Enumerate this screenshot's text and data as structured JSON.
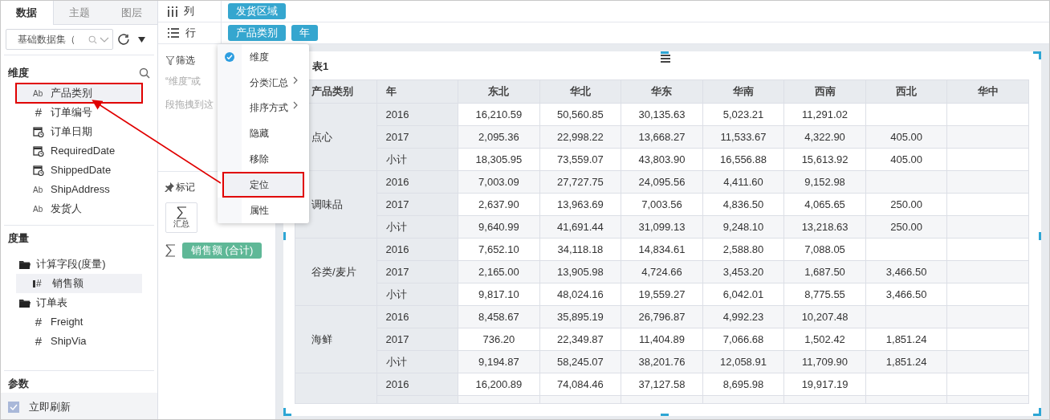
{
  "sidebar": {
    "tabs": [
      {
        "label": "数据",
        "selected": true
      },
      {
        "label": "主题",
        "selected": false
      },
      {
        "label": "图层",
        "selected": false
      }
    ],
    "dataset": {
      "value": "基础数据集（"
    },
    "dimensions": {
      "title": "维度",
      "items": [
        {
          "kind": "text",
          "glyph": "Ab",
          "label": "产品类别",
          "selected": true,
          "annotated": true
        },
        {
          "kind": "number",
          "glyph": "#",
          "label": "订单编号",
          "selected": false,
          "annotated": false
        },
        {
          "kind": "date",
          "label": "订单日期",
          "selected": false,
          "annotated": false
        },
        {
          "kind": "date",
          "label": "RequiredDate",
          "selected": false,
          "annotated": false
        },
        {
          "kind": "date",
          "label": "ShippedDate",
          "selected": false,
          "annotated": false
        },
        {
          "kind": "text",
          "glyph": "Ab",
          "label": "ShipAddress",
          "selected": false,
          "annotated": false
        },
        {
          "kind": "text",
          "glyph": "Ab",
          "label": "发货人",
          "selected": false,
          "annotated": false
        }
      ]
    },
    "measures": {
      "title": "度量",
      "folders": [
        {
          "label": "计算字段(度量)",
          "children": [
            {
              "kind": "measure",
              "glyph": "#",
              "label": "销售额",
              "selected": true
            }
          ]
        },
        {
          "label": "订单表",
          "children": [
            {
              "kind": "number",
              "glyph": "#",
              "label": "Freight",
              "selected": false
            },
            {
              "kind": "number",
              "glyph": "#",
              "label": "ShipVia",
              "selected": false
            }
          ]
        }
      ]
    },
    "params": {
      "title": "参数"
    },
    "auto_refresh": {
      "label": "立即刷新",
      "checked": true
    }
  },
  "shelves": [
    {
      "kind": "columns",
      "label": "列",
      "pills": [
        "发货区域"
      ]
    },
    {
      "kind": "rows",
      "label": "行",
      "pills": [
        "产品类别",
        "年"
      ]
    }
  ],
  "filter": {
    "title": "筛选",
    "hint_lines": [
      "“维度”或",
      "段拖拽到这"
    ]
  },
  "marks": {
    "title": "标记",
    "button": "汇总",
    "measure_pill": "销售额 (合计)"
  },
  "context_menu": {
    "items": [
      {
        "label": "维度",
        "checked": true,
        "submenu": false,
        "hovered": false,
        "annotated": false
      },
      {
        "label": "分类汇总",
        "checked": false,
        "submenu": true,
        "hovered": false,
        "annotated": false
      },
      {
        "label": "排序方式",
        "checked": false,
        "submenu": true,
        "hovered": false,
        "annotated": false
      },
      {
        "label": "隐藏",
        "checked": false,
        "submenu": false,
        "hovered": false,
        "annotated": false
      },
      {
        "label": "移除",
        "checked": false,
        "submenu": false,
        "hovered": false,
        "annotated": false
      },
      {
        "label": "定位",
        "checked": false,
        "submenu": false,
        "hovered": true,
        "annotated": true
      },
      {
        "label": "属性",
        "checked": false,
        "submenu": false,
        "hovered": false,
        "annotated": false
      }
    ]
  },
  "table": {
    "title": "表1",
    "columns": [
      "产品类别",
      "年",
      "东北",
      "华北",
      "华东",
      "华南",
      "西南",
      "西北",
      "华中"
    ],
    "groups": [
      {
        "category": "点心",
        "rows": [
          {
            "year": "2016",
            "values": [
              "16,210.59",
              "50,560.85",
              "30,135.63",
              "5,023.21",
              "11,291.02"
            ]
          },
          {
            "year": "2017",
            "values": [
              "2,095.36",
              "22,998.22",
              "13,668.27",
              "11,533.67",
              "4,322.90",
              "405.00"
            ]
          },
          {
            "year": "小计",
            "values": [
              "18,305.95",
              "73,559.07",
              "43,803.90",
              "16,556.88",
              "15,613.92",
              "405.00"
            ]
          }
        ]
      },
      {
        "category": "调味品",
        "rows": [
          {
            "year": "2016",
            "values": [
              "7,003.09",
              "27,727.75",
              "24,095.56",
              "4,411.60",
              "9,152.98"
            ]
          },
          {
            "year": "2017",
            "values": [
              "2,637.90",
              "13,963.69",
              "7,003.56",
              "4,836.50",
              "4,065.65",
              "250.00"
            ]
          },
          {
            "year": "小计",
            "values": [
              "9,640.99",
              "41,691.44",
              "31,099.13",
              "9,248.10",
              "13,218.63",
              "250.00"
            ]
          }
        ]
      },
      {
        "category": "谷类/麦片",
        "rows": [
          {
            "year": "2016",
            "values": [
              "7,652.10",
              "34,118.18",
              "14,834.61",
              "2,588.80",
              "7,088.05"
            ]
          },
          {
            "year": "2017",
            "values": [
              "2,165.00",
              "13,905.98",
              "4,724.66",
              "3,453.20",
              "1,687.50",
              "3,466.50"
            ]
          },
          {
            "year": "小计",
            "values": [
              "9,817.10",
              "48,024.16",
              "19,559.27",
              "6,042.01",
              "8,775.55",
              "3,466.50"
            ]
          }
        ]
      },
      {
        "category": "海鲜",
        "rows": [
          {
            "year": "2016",
            "values": [
              "8,458.67",
              "35,895.19",
              "26,796.87",
              "4,992.23",
              "10,207.48"
            ]
          },
          {
            "year": "2017",
            "values": [
              "736.20",
              "22,349.87",
              "11,404.89",
              "7,066.68",
              "1,502.42",
              "1,851.24"
            ]
          },
          {
            "year": "小计",
            "values": [
              "9,194.87",
              "58,245.07",
              "38,201.76",
              "12,058.91",
              "11,709.90",
              "1,851.24"
            ]
          }
        ]
      },
      {
        "rows": [
          {
            "year": "2016",
            "values": [
              "16,200.89",
              "74,084.46",
              "37,127.58",
              "8,695.98",
              "19,917.19"
            ]
          }
        ]
      }
    ]
  }
}
